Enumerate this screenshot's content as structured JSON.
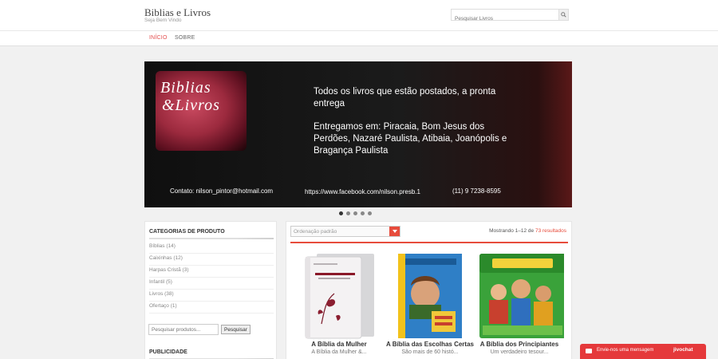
{
  "header": {
    "site_title": "Biblias e Livros",
    "tagline": "Seja Bem Vindo",
    "search_placeholder": "Pesquisar Livros"
  },
  "nav": {
    "items": [
      {
        "label": "INÍCIO",
        "active": true
      },
      {
        "label": "SOBRE",
        "active": false
      }
    ]
  },
  "banner": {
    "logo_line1": "Biblias",
    "logo_line2": "&Livros",
    "text_para1": "Todos os livros que estão postados, a pronta entrega",
    "text_para2": "Entregamos em: Piracaia, Bom Jesus dos Perdões, Nazaré Paulista, Atibaia, Joanópolis e Bragança Paulista",
    "contact": "Contato: nilson_pintor@hotmail.com",
    "facebook": "https://www.facebook.com/nilson.presb.1",
    "phone": "(11) 9 7238-8595",
    "slide_count": 5,
    "active_slide": 1
  },
  "sidebar": {
    "categories_heading": "CATEGORIAS DE PRODUTO",
    "categories": [
      {
        "label": "Bíblias (14)"
      },
      {
        "label": "Caixinhas (12)"
      },
      {
        "label": "Harpas Cristã (3)"
      },
      {
        "label": "Infantil (5)"
      },
      {
        "label": "Livros (38)"
      },
      {
        "label": "Ofertaço (1)"
      }
    ],
    "search_placeholder": "Pesquisar produtos...",
    "search_button": "Pesquisar",
    "publicidade_heading": "PUBLICIDADE"
  },
  "main": {
    "sort_label": "Ordenação padrão",
    "result_prefix": "Mostrando 1–12 de ",
    "result_total": "73 resultados",
    "products": [
      {
        "name": "A Bíblia da Mulher",
        "desc": "A Bíblia da Mulher &..."
      },
      {
        "name": "A Bíblia das Escolhas Certas",
        "desc": "São mais de 60 histó..."
      },
      {
        "name": "A Bíblia dos Principiantes",
        "desc": "Um verdadeiro tesour..."
      }
    ]
  },
  "chat": {
    "label": "Envie-nos uma mensagem",
    "brand": "jivochat"
  },
  "colors": {
    "accent": "#e74c3c",
    "chat": "#e5393b",
    "nav_active": "#e34b4b"
  }
}
